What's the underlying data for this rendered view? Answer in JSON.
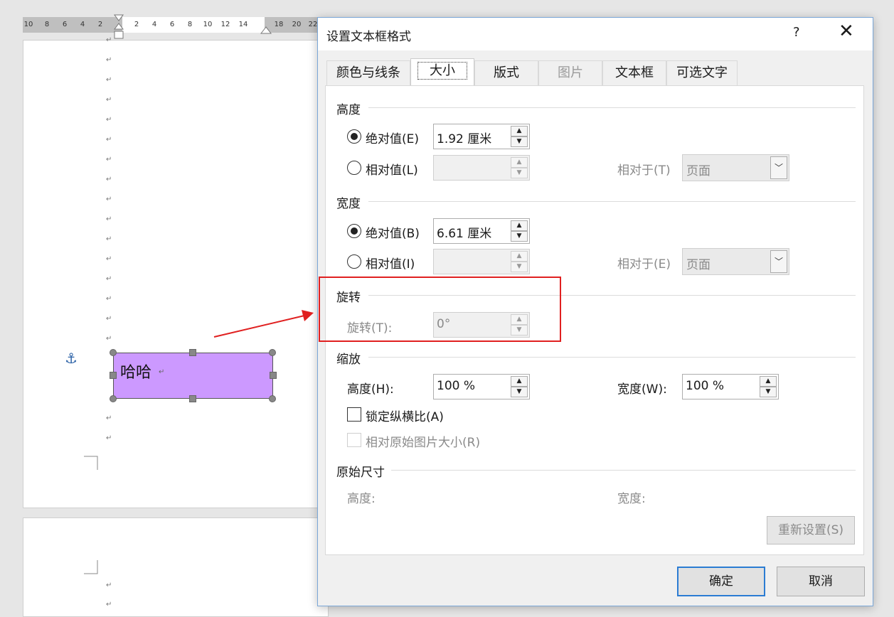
{
  "ruler": {
    "ticks": [
      "10",
      "8",
      "6",
      "4",
      "2",
      "2",
      "4",
      "6",
      "8",
      "10",
      "12",
      "14",
      "18",
      "20",
      "22"
    ]
  },
  "document": {
    "para_mark": "↵",
    "anchor_icon": "anchor-icon",
    "textbox_text": "哈哈",
    "textbox_color": "#cc99ff"
  },
  "dialog": {
    "title": "设置文本框格式",
    "help": "?",
    "close": "✕",
    "tabs": [
      {
        "label": "颜色与线条"
      },
      {
        "label": "大小"
      },
      {
        "label": "版式"
      },
      {
        "label": "图片"
      },
      {
        "label": "文本框"
      },
      {
        "label": "可选文字"
      }
    ],
    "height": {
      "section": "高度",
      "absolute_label": "绝对值(E)",
      "absolute_value": "1.92 厘米",
      "relative_label": "相对值(L)",
      "relative_to_label": "相对于(T)",
      "relative_to_value": "页面"
    },
    "width": {
      "section": "宽度",
      "absolute_label": "绝对值(B)",
      "absolute_value": "6.61 厘米",
      "relative_label": "相对值(I)",
      "relative_to_label": "相对于(E)",
      "relative_to_value": "页面"
    },
    "rotation": {
      "section": "旋转",
      "label": "旋转(T):",
      "value": "0°"
    },
    "scale": {
      "section": "缩放",
      "height_label": "高度(H):",
      "height_value": "100 %",
      "width_label": "宽度(W):",
      "width_value": "100 %",
      "lock_label": "锁定纵横比(A)",
      "relative_original_label": "相对原始图片大小(R)"
    },
    "original": {
      "section": "原始尺寸",
      "height_label": "高度:",
      "width_label": "宽度:",
      "reset_label": "重新设置(S)"
    },
    "ok_label": "确定",
    "cancel_label": "取消"
  },
  "annotation_color": "#e02020"
}
